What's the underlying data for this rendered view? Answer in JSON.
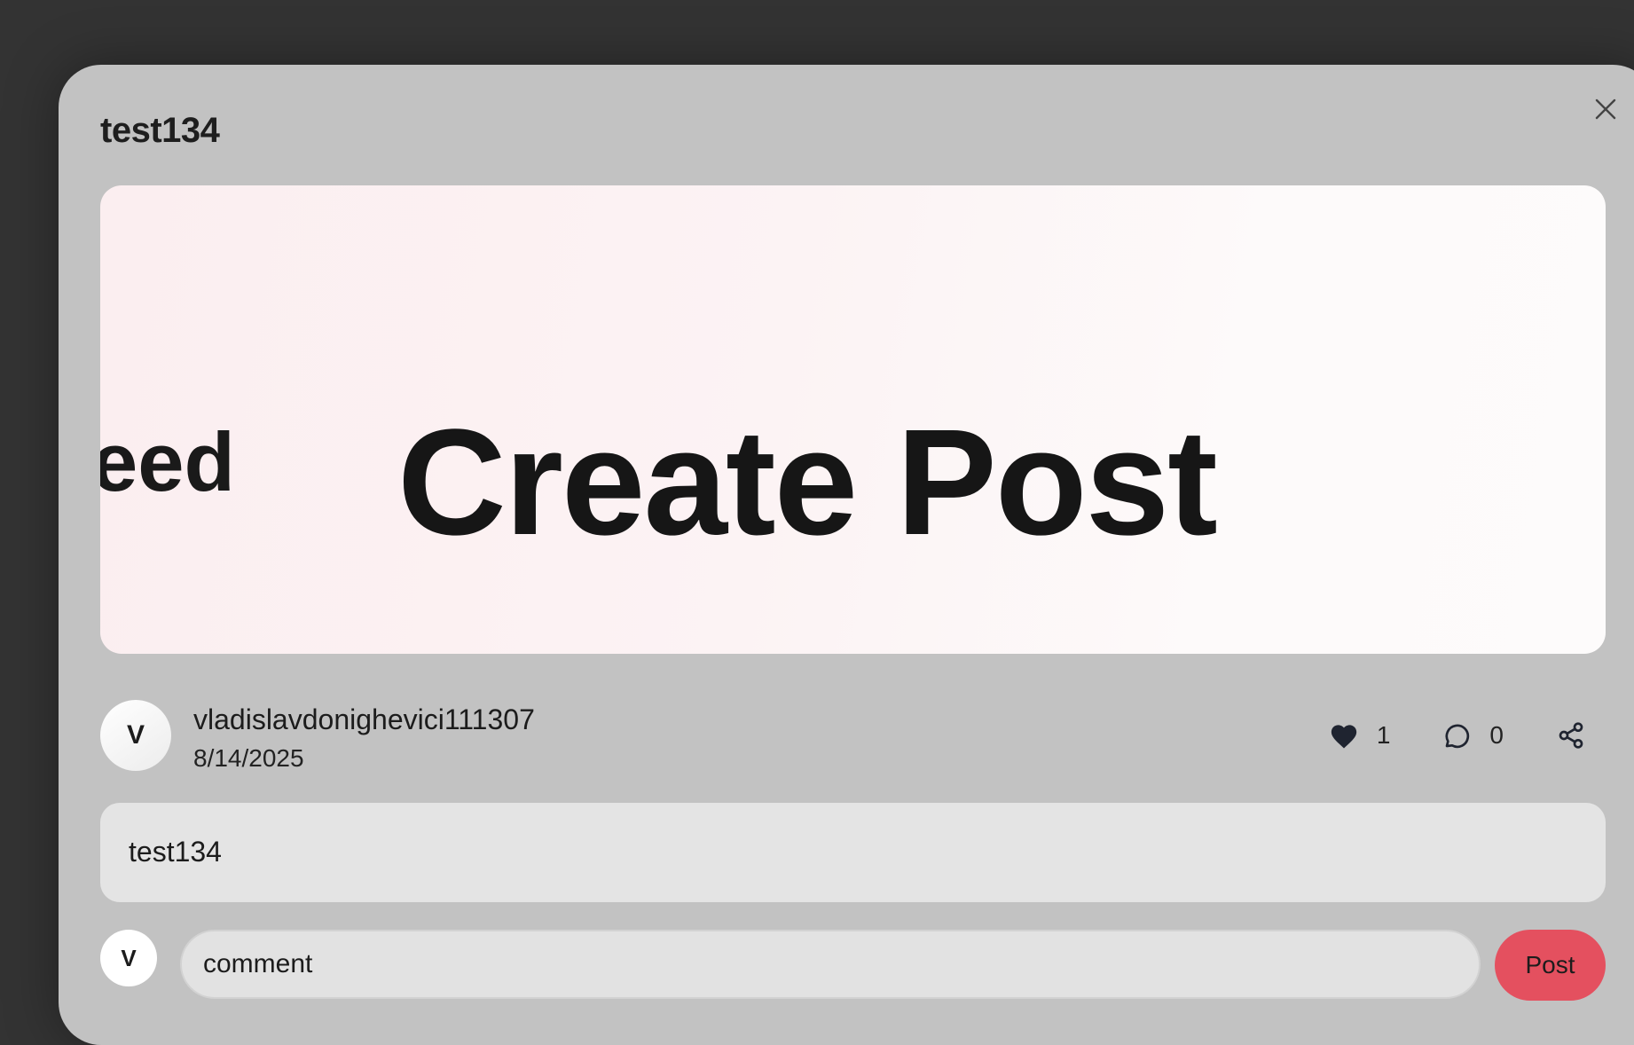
{
  "modal": {
    "title": "test134",
    "close_icon": "close-icon"
  },
  "post": {
    "image": {
      "side_text": "eed",
      "main_text": "Create Post"
    },
    "author": {
      "avatar_initial": "V",
      "username": "vladislavdonighevici111307",
      "date": "8/14/2025"
    },
    "actions": {
      "like_icon": "heart-icon",
      "like_count": "1",
      "comment_icon": "comment-bubble-icon",
      "comment_count": "0",
      "share_icon": "share-icon"
    },
    "caption": "test134"
  },
  "comment_box": {
    "avatar_initial": "V",
    "placeholder": "comment",
    "post_label": "Post"
  },
  "colors": {
    "backdrop": "#333333",
    "modal_bg": "#c2c2c2",
    "post_button": "#e4505f"
  }
}
